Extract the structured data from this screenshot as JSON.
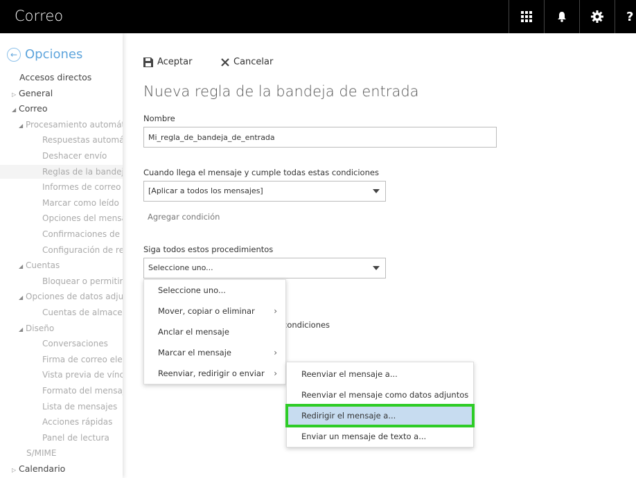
{
  "app": {
    "title": "Correo"
  },
  "topbar": {
    "icons": [
      "grid-icon",
      "bell-icon",
      "gear-icon",
      "help-icon"
    ],
    "help_glyph": "?"
  },
  "sidebar": {
    "header": "Opciones",
    "items": [
      {
        "label": "Accesos directos",
        "level": 0,
        "expand": ""
      },
      {
        "label": "General",
        "level": 0,
        "expand": "collapsed"
      },
      {
        "label": "Correo",
        "level": 0,
        "expand": "expanded"
      },
      {
        "label": "Procesamiento automát",
        "level": 1,
        "expand": "expanded"
      },
      {
        "label": "Respuestas automátic",
        "level": 2,
        "expand": ""
      },
      {
        "label": "Deshacer envío",
        "level": 2,
        "expand": ""
      },
      {
        "label": "Reglas de la bandeja d",
        "level": 2,
        "expand": "",
        "selected": true
      },
      {
        "label": "Informes de correo no",
        "level": 2,
        "expand": ""
      },
      {
        "label": "Marcar como leído",
        "level": 2,
        "expand": ""
      },
      {
        "label": "Opciones del mensaje",
        "level": 2,
        "expand": ""
      },
      {
        "label": "Confirmaciones de lec",
        "level": 2,
        "expand": ""
      },
      {
        "label": "Configuración de resp",
        "level": 2,
        "expand": ""
      },
      {
        "label": "Cuentas",
        "level": 1,
        "expand": "expanded"
      },
      {
        "label": "Bloquear o permitir",
        "level": 2,
        "expand": ""
      },
      {
        "label": "Opciones de datos adju",
        "level": 1,
        "expand": "expanded"
      },
      {
        "label": "Cuentas de almacenam",
        "level": 2,
        "expand": ""
      },
      {
        "label": "Diseño",
        "level": 1,
        "expand": "expanded"
      },
      {
        "label": "Conversaciones",
        "level": 2,
        "expand": ""
      },
      {
        "label": "Firma de correo electr",
        "level": 2,
        "expand": ""
      },
      {
        "label": "Vista previa de vínculo",
        "level": 2,
        "expand": ""
      },
      {
        "label": "Formato del mensaje",
        "level": 2,
        "expand": ""
      },
      {
        "label": "Lista de mensajes",
        "level": 2,
        "expand": ""
      },
      {
        "label": "Acciones rápidas",
        "level": 2,
        "expand": ""
      },
      {
        "label": "Panel de lectura",
        "level": 2,
        "expand": ""
      },
      {
        "label": "S/MIME",
        "level": 1,
        "expand": ""
      },
      {
        "label": "Calendario",
        "level": 0,
        "expand": "collapsed"
      }
    ]
  },
  "toolbar": {
    "accept_label": "Aceptar",
    "cancel_label": "Cancelar"
  },
  "form": {
    "title": "Nueva regla de la bandeja de entrada",
    "name_label": "Nombre",
    "name_value": "Mi_regla_de_bandeja_de_entrada",
    "conditions_label": "Cuando llega el mensaje y cumple todas estas condiciones",
    "conditions_value": "[Aplicar a todos los mensajes]",
    "add_condition": "Agregar condición",
    "actions_label": "Siga todos estos procedimientos",
    "actions_value": "Seleccione uno...",
    "partial_text": "condiciones"
  },
  "action_menu": {
    "items": [
      {
        "label": "Seleccione uno...",
        "submenu": false
      },
      {
        "label": "Mover, copiar o eliminar",
        "submenu": true
      },
      {
        "label": "Anclar el mensaje",
        "submenu": false
      },
      {
        "label": "Marcar el mensaje",
        "submenu": true
      },
      {
        "label": "Reenviar, redirigir o enviar",
        "submenu": true
      }
    ],
    "arrow": "›"
  },
  "forward_submenu": {
    "items": [
      {
        "label": "Reenviar el mensaje a..."
      },
      {
        "label": "Reenviar el mensaje como datos adjuntos a..."
      },
      {
        "label": "Redirigir el mensaje a...",
        "highlighted": true
      },
      {
        "label": "Enviar un mensaje de texto a..."
      }
    ]
  },
  "colors": {
    "highlight_border": "#2ecc26",
    "highlight_fill": "#c7dcf0",
    "accent": "#5da4dc"
  }
}
